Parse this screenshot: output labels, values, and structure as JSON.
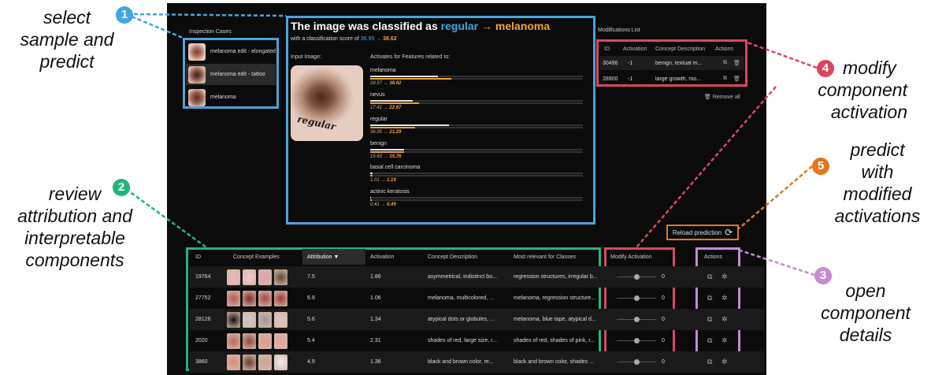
{
  "annotations": {
    "a1": {
      "num": "1",
      "text": [
        "select",
        "sample and",
        "predict"
      ],
      "color": "#41a7e0"
    },
    "a2": {
      "num": "2",
      "text": [
        "review",
        "attribution and",
        "interpretable",
        "components"
      ],
      "color": "#22b57a"
    },
    "a3": {
      "num": "3",
      "text": [
        "open",
        "component",
        "details"
      ],
      "color": "#c58ad0"
    },
    "a4": {
      "num": "4",
      "text": [
        "modify",
        "component",
        "activation"
      ],
      "color": "#d9465f"
    },
    "a5": {
      "num": "5",
      "text": [
        "predict",
        "with",
        "modified",
        "activations"
      ],
      "color": "#e0781c"
    }
  },
  "inspection": {
    "title": "Inspection Cases",
    "cases": [
      {
        "label": "melanoma edit - elongated"
      },
      {
        "label": "melanoma edit - tattoo"
      },
      {
        "label": "melanoma"
      }
    ]
  },
  "classification": {
    "prefix": "The image was classified as",
    "from": "regular",
    "arrow": "→",
    "to": "melanoma",
    "score_prefix": "with a classification score of",
    "score_from": "36.95",
    "score_to": "38.62",
    "input_label": "Input Image:",
    "image_caption": "regular",
    "features_label": "Activates for Features related to:",
    "features": [
      {
        "name": "melanoma",
        "from": "28.57",
        "to": "38.62",
        "w1": 0.32,
        "w2": 0.38
      },
      {
        "name": "nevus",
        "from": "17.41",
        "to": "22.67",
        "w1": 0.2,
        "w2": 0.23
      },
      {
        "name": "regular",
        "from": "36.95",
        "to": "21.29",
        "w1": 0.37,
        "w2": 0.21
      },
      {
        "name": "benign",
        "from": "15.63",
        "to": "15.76",
        "w1": 0.16,
        "w2": 0.16
      },
      {
        "name": "basal cell carcinoma",
        "from": "1.01",
        "to": "1.19",
        "w1": 0.01,
        "w2": 0.012
      },
      {
        "name": "actinic keratosis",
        "from": "0.41",
        "to": "0.49",
        "w1": 0.005,
        "w2": 0.006
      }
    ]
  },
  "modifications": {
    "title": "Modifications List",
    "headers": [
      "ID",
      "Activation",
      "Concept Description",
      "Actions"
    ],
    "rows": [
      {
        "id": "30496",
        "activation": "-1",
        "desc": "benign, textual m..."
      },
      {
        "id": "28900",
        "activation": "-1",
        "desc": "large growth, mo..."
      }
    ],
    "remove_all": "Remove all"
  },
  "reload": {
    "label": "Reload prediction"
  },
  "table": {
    "headers": {
      "id": "ID",
      "examples": "Concept Examples",
      "attribution": "Attribution ▼",
      "activation": "Activation",
      "desc": "Concept Description",
      "classes": "Most relevant for Classes",
      "modify": "Modify Activation",
      "actions": "Actions"
    },
    "rows": [
      {
        "id": "19764",
        "attribution": "7.5",
        "activation": "1.86",
        "desc": "asymmetrical, indistinct bo...",
        "classes": "regression structures, irregular b...",
        "modify": "0"
      },
      {
        "id": "27752",
        "attribution": "6.9",
        "activation": "1.06",
        "desc": "melanoma, multicolored, ...",
        "classes": "melanoma, regression structure...",
        "modify": "0"
      },
      {
        "id": "28126",
        "attribution": "5.6",
        "activation": "1.34",
        "desc": "atypical dots or globules, ...",
        "classes": "melanoma, blue tape, atypical d...",
        "modify": "0"
      },
      {
        "id": "2020",
        "attribution": "5.4",
        "activation": "2.31",
        "desc": "shades of red, large size, r...",
        "classes": "shades of red, shades of pink, r...",
        "modify": "0"
      },
      {
        "id": "3860",
        "attribution": "4.9",
        "activation": "1.36",
        "desc": "black and brown color, re...",
        "classes": "black and brown color, shades ...",
        "modify": "0"
      }
    ]
  }
}
